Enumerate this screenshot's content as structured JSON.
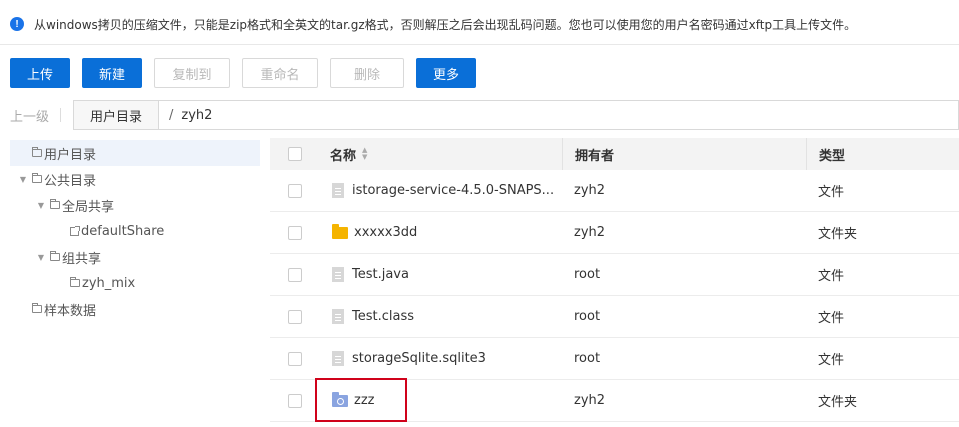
{
  "notice": "从windows拷贝的压缩文件，只能是zip格式和全英文的tar.gz格式，否则解压之后会出现乱码问题。您也可以使用您的用户名密码通过xftp工具上传文件。",
  "toolbar": {
    "upload": "上传",
    "new": "新建",
    "copy_to": "复制到",
    "rename": "重命名",
    "delete": "删除",
    "more": "更多"
  },
  "path": {
    "up_level": "上一级",
    "root": "用户目录",
    "current": "zyh2"
  },
  "tree": [
    {
      "label": "用户目录",
      "depth": 0,
      "type": "folder",
      "selected": true
    },
    {
      "label": "公共目录",
      "depth": 0,
      "type": "folder",
      "expanded": true
    },
    {
      "label": "全局共享",
      "depth": 1,
      "type": "folder",
      "expanded": true
    },
    {
      "label": "defaultShare",
      "depth": 2,
      "type": "share"
    },
    {
      "label": "组共享",
      "depth": 1,
      "type": "folder",
      "expanded": true
    },
    {
      "label": "zyh_mix",
      "depth": 2,
      "type": "folder"
    },
    {
      "label": "样本数据",
      "depth": 0,
      "type": "folder"
    }
  ],
  "table": {
    "headers": {
      "name": "名称",
      "owner": "拥有者",
      "type": "类型"
    },
    "rows": [
      {
        "name": "istorage-service-4.5.0-SNAPS...",
        "owner": "zyh2",
        "type": "文件",
        "icon": "file-icon"
      },
      {
        "name": "xxxxx3dd",
        "owner": "zyh2",
        "type": "文件夹",
        "icon": "folder-icon"
      },
      {
        "name": "Test.java",
        "owner": "root",
        "type": "文件",
        "icon": "file-icon"
      },
      {
        "name": "Test.class",
        "owner": "root",
        "type": "文件",
        "icon": "file-icon"
      },
      {
        "name": "storageSqlite.sqlite3",
        "owner": "root",
        "type": "文件",
        "icon": "file-icon"
      },
      {
        "name": "zzz",
        "owner": "zyh2",
        "type": "文件夹",
        "icon": "shared-folder-icon"
      }
    ]
  },
  "colors": {
    "primary": "#0a6fd8",
    "highlight": "#d0021b",
    "folder": "#f5b400"
  }
}
